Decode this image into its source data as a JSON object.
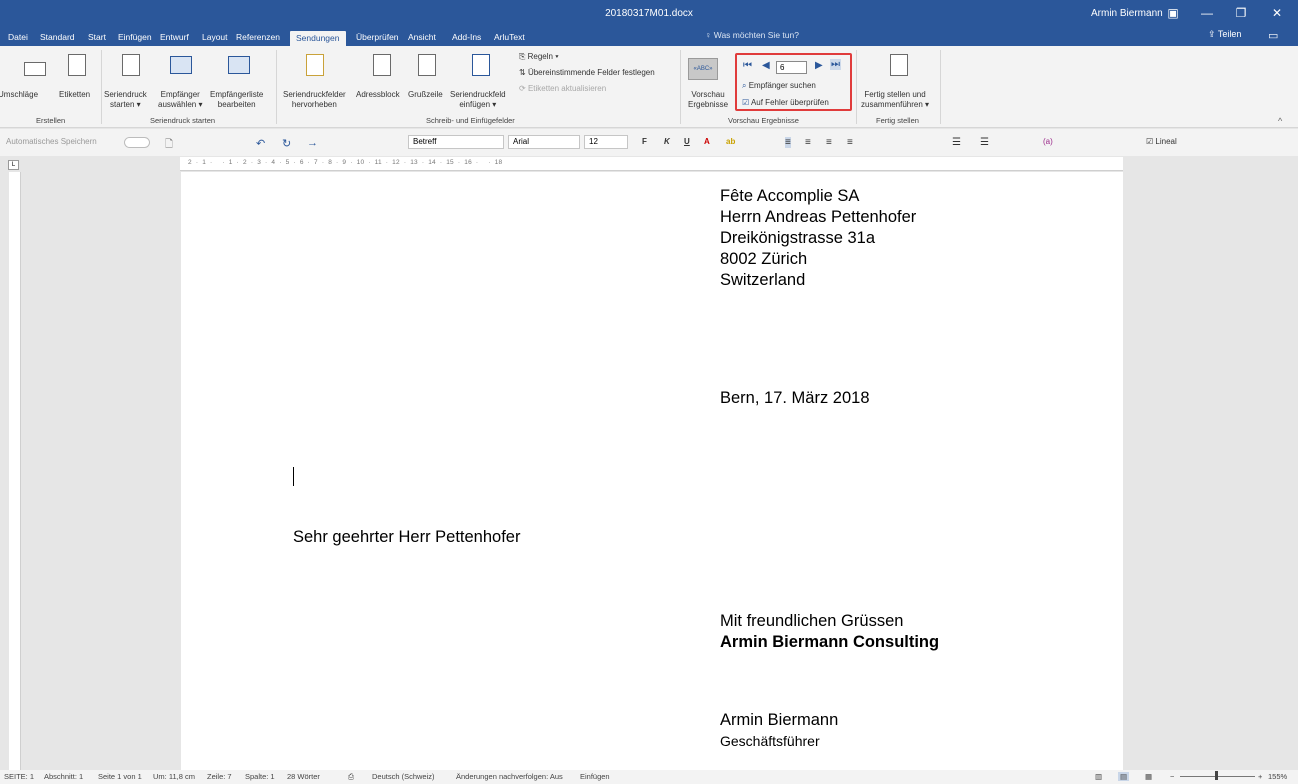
{
  "window": {
    "title": "20180317M01.docx",
    "user": "Armin Biermann"
  },
  "tabs": [
    "Datei",
    "Standard",
    "Start",
    "Einfügen",
    "Entwurf",
    "Layout",
    "Referenzen",
    "Sendungen",
    "Überprüfen",
    "Ansicht",
    "Add-Ins",
    "ArluText"
  ],
  "tellme": "Was möchten Sie tun?",
  "share": "Teilen",
  "ribbon": {
    "umschlaege": "Umschläge",
    "etiketten": "Etiketten",
    "grp_erstellen": "Erstellen",
    "seriendruck_l1": "Seriendruck",
    "seriendruck_l2": "starten ▾",
    "empfaenger_l1": "Empfänger",
    "empfaenger_l2": "auswählen ▾",
    "empfliste_l1": "Empfängerliste",
    "empfliste_l2": "bearbeiten",
    "grp_seriendruck": "Seriendruck starten",
    "felder_l1": "Seriendruckfelder",
    "felder_l2": "hervorheben",
    "adressblock": "Adressblock",
    "grusszeile": "Grußzeile",
    "feld_l1": "Seriendruckfeld",
    "feld_l2": "einfügen ▾",
    "regeln": "Regeln ▾",
    "uebereinstimmende": "Übereinstimmende Felder festlegen",
    "etiketten_akt": "Etiketten aktualisieren",
    "grp_schreib": "Schreib- und Einfügefelder",
    "vorschau_l1": "Vorschau",
    "vorschau_l2": "Ergebnisse",
    "record": "6",
    "empf_suchen": "Empfänger suchen",
    "fehler": "Auf Fehler überprüfen",
    "grp_vorschau": "Vorschau Ergebnisse",
    "fertig_l1": "Fertig stellen und",
    "fertig_l2": "zusammenführen ▾",
    "grp_fertig": "Fertig stellen"
  },
  "qat": {
    "autosave": "Automatisches Speichern",
    "style": "Betreff",
    "font": "Arial",
    "size": "12",
    "lineal": "Lineal"
  },
  "ruler_text": "2  ·  1  ·     ·  1  ·  2  ·  3  ·  4  ·  5  ·  6  ·  7  ·  8  ·  9  ·  10  ·  11  ·  12  ·  13  ·  14  ·  15  ·  16  ·     ·  18",
  "letter": {
    "addr1": "Fête Accomplie SA",
    "addr2": "Herrn Andreas Pettenhofer",
    "addr3": "Dreikönigstrasse 31a",
    "addr4": "8002 Zürich",
    "addr5": "Switzerland",
    "date": "Bern, 17. März 2018",
    "salutation": "Sehr geehrter Herr Pettenhofer",
    "closing": "Mit freundlichen Grüssen",
    "company": "Armin Biermann Consulting",
    "signer": "Armin Biermann",
    "role": "Geschäftsführer"
  },
  "status": {
    "seite": "SEITE: 1",
    "abschnitt": "Abschnitt: 1",
    "seitevon": "Seite 1 von 1",
    "um": "Um: 11,8 cm",
    "zeile": "Zeile: 7",
    "spalte": "Spalte: 1",
    "woerter": "28 Wörter",
    "sprache": "Deutsch (Schweiz)",
    "aenderungen": "Änderungen nachverfolgen: Aus",
    "einfuegen": "Einfügen",
    "zoom": "155%"
  },
  "colors": {
    "brand": "#2b579a",
    "highlight": "#e03b3b"
  }
}
